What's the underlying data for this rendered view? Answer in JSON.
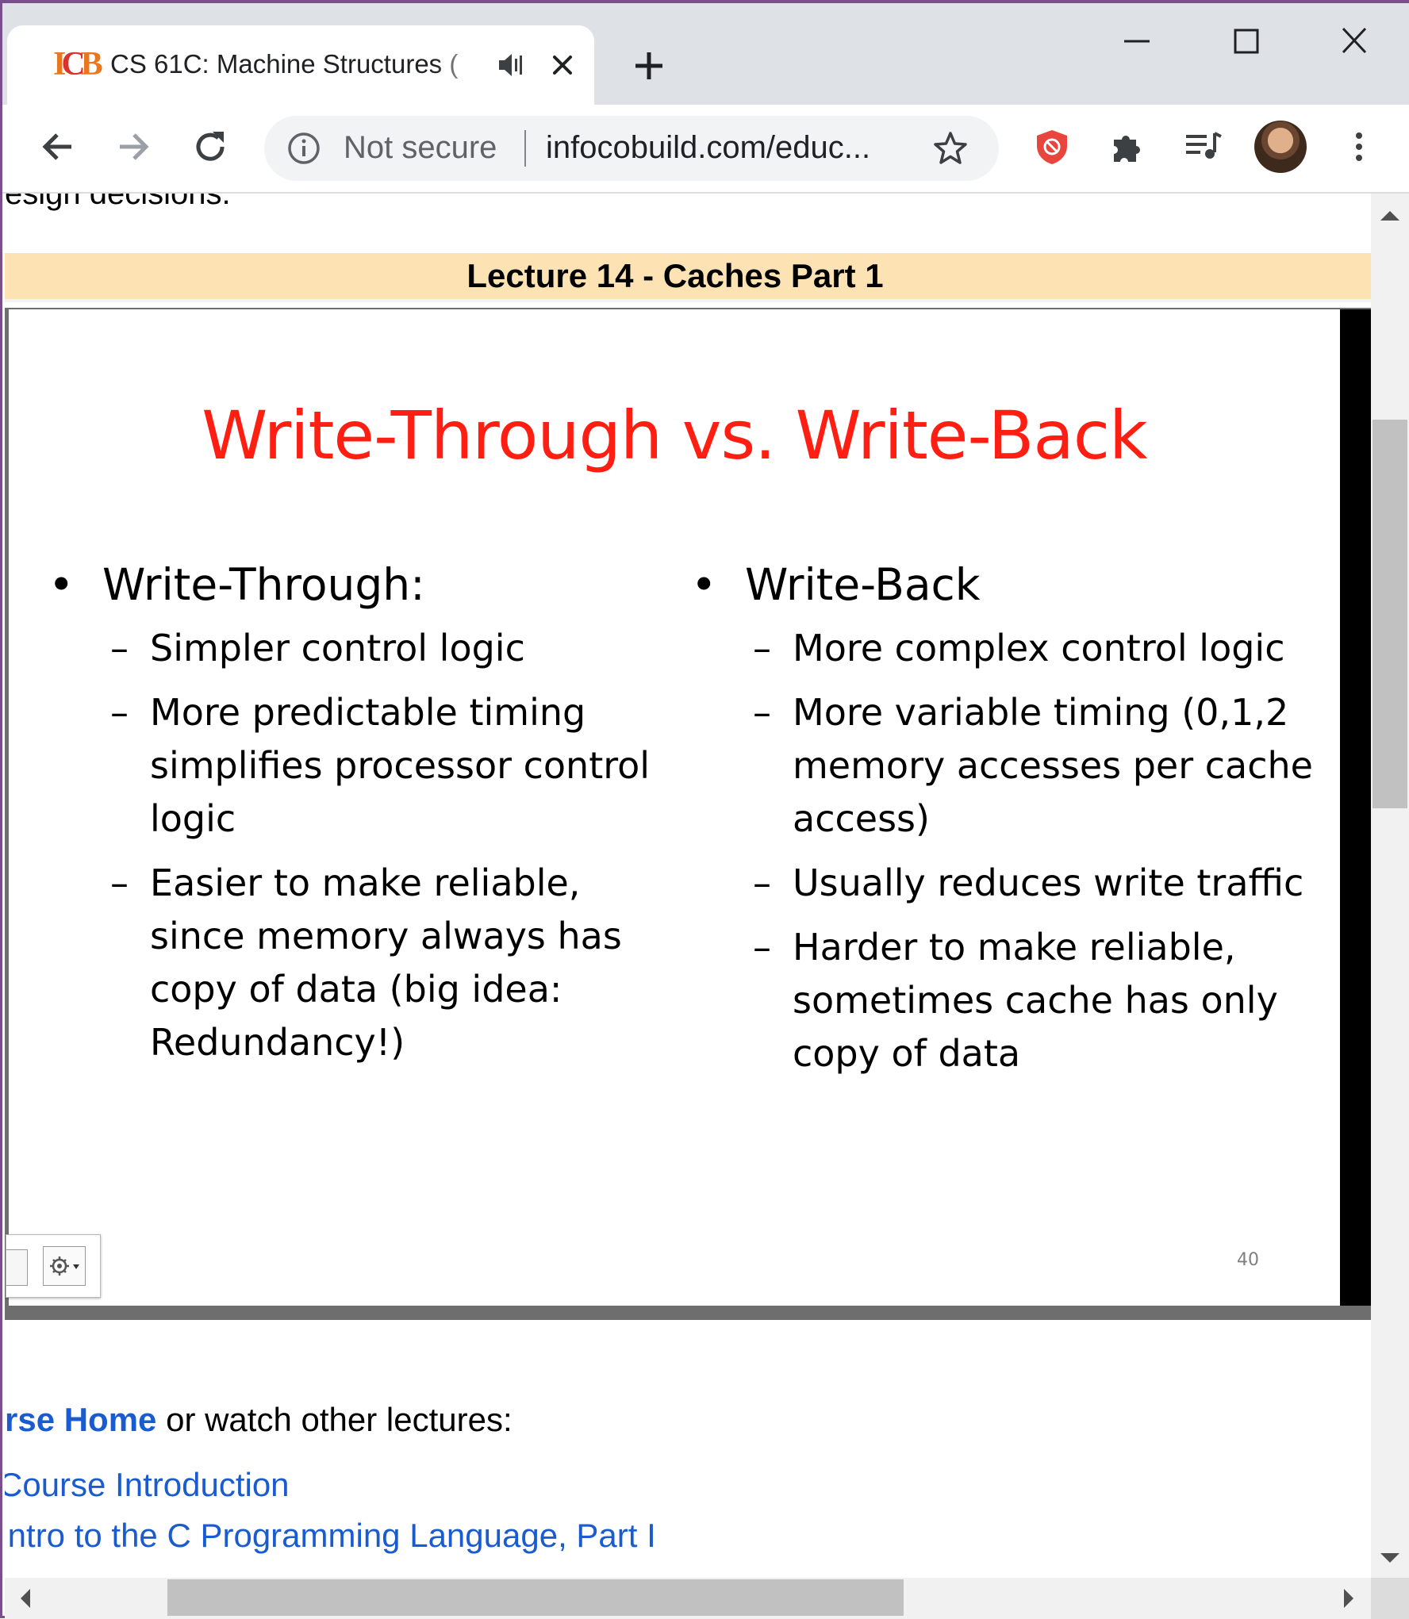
{
  "browser": {
    "tab": {
      "title": "CS 61C: Machine Structures ("
    },
    "omnibox": {
      "security_label": "Not secure",
      "url": "infocobuild.com/educ..."
    },
    "colors": {
      "tabstrip": "#dee1e6",
      "omnibox": "#f1f3f4",
      "frame": "#7a4d8c"
    },
    "icons": [
      "audio-icon",
      "close-icon",
      "plus-icon",
      "minimize-icon",
      "maximize-icon",
      "window-close-icon",
      "back-arrow-icon",
      "forward-arrow-icon",
      "reload-icon",
      "info-icon",
      "star-icon",
      "shield-extension-icon",
      "puzzle-icon",
      "media-queue-icon",
      "avatar",
      "kebab-menu-icon"
    ]
  },
  "page": {
    "intro_tail": "esign decisions.",
    "lecture_title": "Lecture 14 - Caches Part 1",
    "slide": {
      "title": "Write-Through vs. Write-Back",
      "left": {
        "heading": "Write-Through:",
        "items": [
          "Simpler control logic",
          "More predictable timing simplifies processor control logic",
          "Easier to make reliable, since memory always has copy of data (big idea: Redundancy!)"
        ]
      },
      "right": {
        "heading": "Write-Back",
        "items": [
          "More complex control logic",
          "More variable timing (0,1,2 memory accesses per cache access)",
          "Usually reduces write traffic",
          "Harder to make reliable, sometimes cache has only copy of data"
        ]
      },
      "slide_number": "40",
      "colors": {
        "title": "#fe1e12",
        "band": "#fde3b3"
      }
    },
    "nav": {
      "course_home_link": "rse Home",
      "suffix": " or watch other lectures:",
      "links": [
        "Course Introduction",
        "Intro to the C Programming Language, Part I"
      ]
    }
  }
}
